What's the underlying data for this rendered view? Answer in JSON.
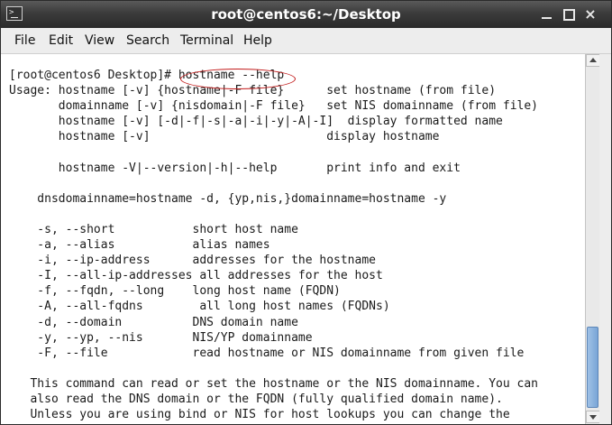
{
  "window": {
    "title": "root@centos6:~/Desktop"
  },
  "menubar": {
    "items": [
      "File",
      "Edit",
      "View",
      "Search",
      "Terminal",
      "Help"
    ]
  },
  "terminal": {
    "lines": [
      "[root@centos6 Desktop]# hostname --help",
      "Usage: hostname [-v] {hostname|-F file}      set hostname (from file)",
      "       domainname [-v] {nisdomain|-F file}   set NIS domainname (from file)",
      "       hostname [-v] [-d|-f|-s|-a|-i|-y|-A|-I]  display formatted name",
      "       hostname [-v]                         display hostname",
      "",
      "       hostname -V|--version|-h|--help       print info and exit",
      "",
      "    dnsdomainname=hostname -d, {yp,nis,}domainname=hostname -y",
      "",
      "    -s, --short           short host name",
      "    -a, --alias           alias names",
      "    -i, --ip-address      addresses for the hostname",
      "    -I, --all-ip-addresses all addresses for the host",
      "    -f, --fqdn, --long    long host name (FQDN)",
      "    -A, --all-fqdns        all long host names (FQDNs)",
      "    -d, --domain          DNS domain name",
      "    -y, --yp, --nis       NIS/YP domainname",
      "    -F, --file            read hostname or NIS domainname from given file",
      "",
      "   This command can read or set the hostname or the NIS domainname. You can",
      "   also read the DNS domain or the FQDN (fully qualified domain name).",
      "   Unless you are using bind or NIS for host lookups you can change the"
    ]
  },
  "colors": {
    "annotation_circle": "#c21a1a",
    "scroll_thumb": "#7aa5d6"
  }
}
